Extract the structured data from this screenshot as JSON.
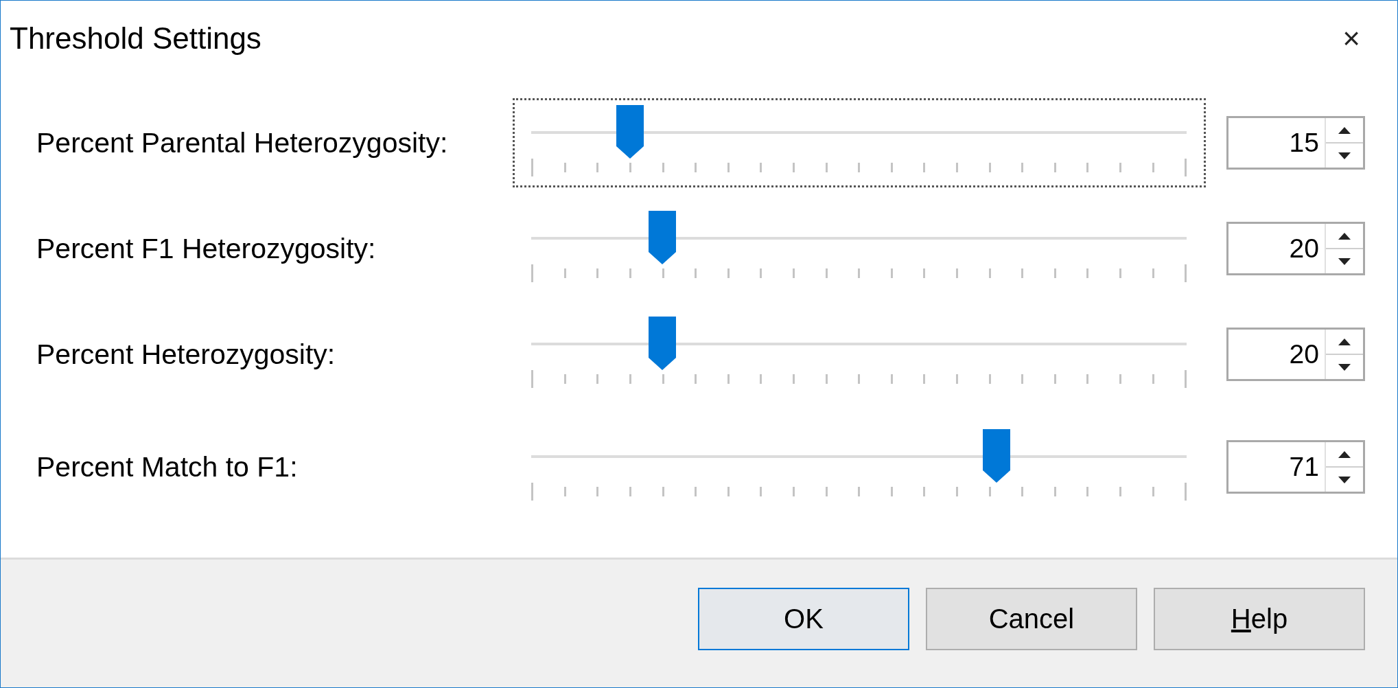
{
  "window": {
    "title": "Threshold Settings",
    "close": "×"
  },
  "settings": [
    {
      "label": "Percent Parental Heterozygosity:",
      "level": 0.15,
      "value": "15",
      "focused": true
    },
    {
      "label": "Percent F1 Heterozygosity:",
      "level": 0.2,
      "value": "20",
      "focused": false
    },
    {
      "label": "Percent Heterozygosity:",
      "level": 0.2,
      "value": "20",
      "focused": false
    },
    {
      "label": "Percent Match to F1:",
      "level": 0.71,
      "value": "71",
      "focused": false
    }
  ],
  "buttons": [
    {
      "label": "OK",
      "default": true
    },
    {
      "label": "Cancel",
      "default": false
    },
    {
      "label_parts": [
        {
          "text": "H",
          "underlined": true
        },
        {
          "text": "elp",
          "underlined": false
        }
      ],
      "default": false
    }
  ]
}
